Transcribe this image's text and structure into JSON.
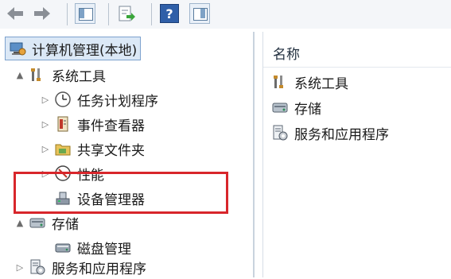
{
  "toolbar": {
    "buttons": [
      {
        "icon": "back-arrow-icon"
      },
      {
        "icon": "forward-arrow-icon"
      },
      {
        "icon": "show-hide-console-tree-icon"
      },
      {
        "icon": "export-list-icon"
      },
      {
        "icon": "help-icon",
        "glyph": "?"
      },
      {
        "icon": "show-hide-action-pane-icon"
      }
    ]
  },
  "tree": {
    "root": "计算机管理(本地)",
    "items": [
      {
        "label": "系统工具",
        "icon": "tools-icon",
        "expander": "▲"
      },
      {
        "label": "任务计划程序",
        "icon": "clock-icon",
        "expander": "▷"
      },
      {
        "label": "事件查看器",
        "icon": "event-log-icon",
        "expander": "▷"
      },
      {
        "label": "共享文件夹",
        "icon": "shared-folder-icon",
        "expander": "▷"
      },
      {
        "label": "性能",
        "icon": "performance-icon",
        "expander": "▷"
      },
      {
        "label": "设备管理器",
        "icon": "device-manager-icon",
        "expander": ""
      },
      {
        "label": "存储",
        "icon": "storage-icon",
        "expander": "▲"
      },
      {
        "label": "磁盘管理",
        "icon": "disk-icon",
        "expander": ""
      },
      {
        "label": "服务和应用程序",
        "icon": "services-icon",
        "expander": "▷"
      }
    ]
  },
  "list": {
    "header": "名称",
    "items": [
      "系统工具",
      "存储",
      "服务和应用程序"
    ]
  },
  "colors": {
    "highlight": "#d8262b",
    "selection": "#dbe8f6"
  }
}
